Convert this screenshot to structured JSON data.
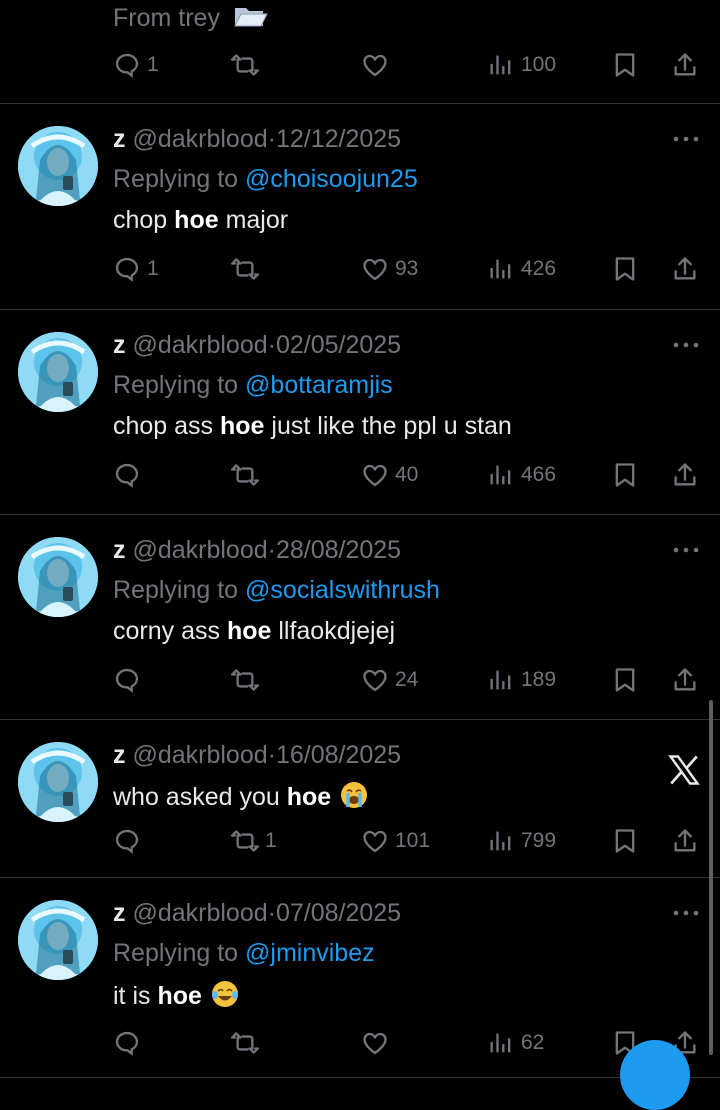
{
  "colors": {
    "background": "#000000",
    "text": "#e7e9ea",
    "muted": "#71767b",
    "link": "#1d9bf0",
    "divider": "#2f3336"
  },
  "top_partial": {
    "text": "From trey",
    "emoji_icon": "open-folder-icon",
    "stats": {
      "replies": "1",
      "retweets": "",
      "likes": "",
      "views": "100"
    }
  },
  "tweets": [
    {
      "name": "z",
      "handle": "@dakrblood",
      "date": "12/12/2025",
      "reply_label": "Replying to",
      "reply_to": "@choisoojun25",
      "text_before": "chop ",
      "text_bold": "hoe",
      "text_after": " major",
      "emoji_icon": "",
      "stats": {
        "replies": "1",
        "retweets": "",
        "likes": "93",
        "views": "426"
      }
    },
    {
      "name": "z",
      "handle": "@dakrblood",
      "date": "02/05/2025",
      "reply_label": "Replying to",
      "reply_to": "@bottaramjis",
      "text_before": "chop ass ",
      "text_bold": "hoe",
      "text_after": " just like the ppl u stan",
      "emoji_icon": "",
      "stats": {
        "replies": "",
        "retweets": "",
        "likes": "40",
        "views": "466"
      }
    },
    {
      "name": "z",
      "handle": "@dakrblood",
      "date": "28/08/2025",
      "reply_label": "Replying to",
      "reply_to": "@socialswithrush",
      "text_before": "corny ass ",
      "text_bold": "hoe",
      "text_after": " llfaokdjejej",
      "emoji_icon": "",
      "stats": {
        "replies": "",
        "retweets": "",
        "likes": "24",
        "views": "189"
      }
    },
    {
      "name": "z",
      "handle": "@dakrblood",
      "date": "16/08/2025",
      "reply_label": "",
      "reply_to": "",
      "text_before": "who asked you ",
      "text_bold": "hoe",
      "text_after": "",
      "emoji_icon": "loudly-crying-face-emoji",
      "stats": {
        "replies": "",
        "retweets": "1",
        "likes": "101",
        "views": "799"
      }
    },
    {
      "name": "z",
      "handle": "@dakrblood",
      "date": "07/08/2025",
      "reply_label": "Replying to",
      "reply_to": "@jminvibez",
      "text_before": "it is ",
      "text_bold": "hoe",
      "text_after": "",
      "emoji_icon": "tears-of-joy-emoji",
      "stats": {
        "replies": "",
        "retweets": "",
        "likes": "",
        "views": "62"
      }
    }
  ],
  "icons": {
    "reply": "reply-icon",
    "retweet": "retweet-icon",
    "like": "heart-icon",
    "views": "views-icon",
    "bookmark": "bookmark-icon",
    "share": "share-icon",
    "more": "more-icon",
    "brand": "x-logo-icon"
  }
}
